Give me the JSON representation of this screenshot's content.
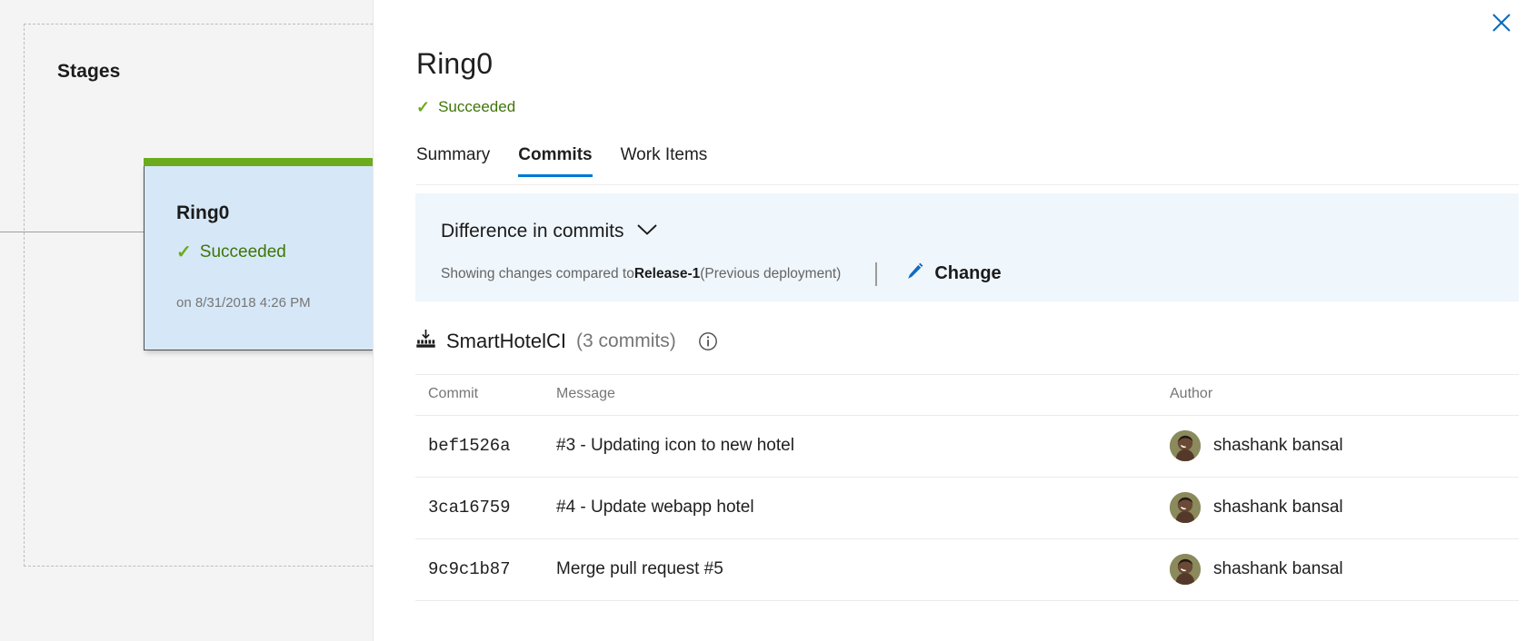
{
  "canvas": {
    "stages_heading": "Stages",
    "stage_card": {
      "name": "Ring0",
      "status": "Succeeded",
      "timestamp": "on 8/31/2018 4:26 PM",
      "status_color": "#3f7507",
      "top_bar_color": "#6cab1d",
      "body_color": "#d6e8f7"
    }
  },
  "panel": {
    "close_icon": "close-icon",
    "title": "Ring0",
    "status": "Succeeded",
    "status_color": "#3f7507",
    "tabs": [
      {
        "label": "Summary",
        "active": false
      },
      {
        "label": "Commits",
        "active": true
      },
      {
        "label": "Work Items",
        "active": false
      }
    ],
    "accent_color": "#0078d4",
    "difference": {
      "heading": "Difference in commits",
      "chevron_icon": "chevron-down-icon",
      "showing_prefix": "Showing changes compared to ",
      "compare_target": "Release-1",
      "showing_suffix": " (Previous deployment)",
      "change_label": "Change",
      "change_icon": "pencil-icon",
      "banner_color": "#eff6fc"
    },
    "artifact": {
      "icon": "artifact-download-icon",
      "name": "SmartHotelCI",
      "commit_count_label": "(3 commits)",
      "info_icon": "info-circle-icon"
    },
    "table": {
      "columns": [
        "Commit",
        "Message",
        "Author"
      ],
      "rows": [
        {
          "commit": "bef1526a",
          "message": "#3 - Updating icon to new hotel",
          "author": "shashank bansal",
          "avatar": "user-avatar"
        },
        {
          "commit": "3ca16759",
          "message": "#4 - Update webapp hotel",
          "author": "shashank bansal",
          "avatar": "user-avatar"
        },
        {
          "commit": "9c9c1b87",
          "message": "Merge pull request #5",
          "author": "shashank bansal",
          "avatar": "user-avatar"
        }
      ]
    }
  }
}
